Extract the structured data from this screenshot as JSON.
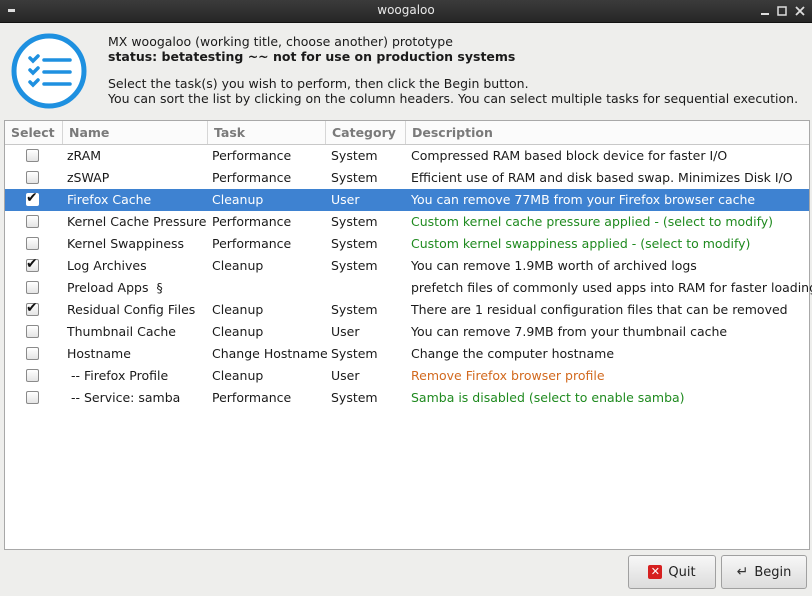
{
  "window": {
    "title": "woogaloo"
  },
  "header": {
    "title": "MX woogaloo (working title, choose another) prototype",
    "status": "status: betatesting ~~ not for use on production systems",
    "instructions_1": "Select the task(s) you wish to perform, then click the Begin button.",
    "instructions_2": "You can sort the list by clicking on the column headers. You can select multiple tasks for sequential execution."
  },
  "table": {
    "columns": [
      "Select",
      "Name",
      "Task",
      "Category",
      "Description"
    ],
    "rows": [
      {
        "checked": false,
        "name": "zRAM",
        "task": "Performance",
        "category": "System",
        "description": "Compressed RAM based block device for faster I/O",
        "desc_color": "normal",
        "selected": false
      },
      {
        "checked": false,
        "name": "zSWAP",
        "task": "Performance",
        "category": "System",
        "description": "Efficient use of RAM and disk based swap. Minimizes Disk I/O",
        "desc_color": "normal",
        "selected": false
      },
      {
        "checked": true,
        "name": "Firefox Cache",
        "task": "Cleanup",
        "category": "User",
        "description": "You can remove 77MB from your Firefox browser cache",
        "desc_color": "normal",
        "selected": true
      },
      {
        "checked": false,
        "name": "Kernel Cache Pressure",
        "task": "Performance",
        "category": "System",
        "description": "Custom kernel cache pressure applied - (select to modify)",
        "desc_color": "green",
        "selected": false
      },
      {
        "checked": false,
        "name": "Kernel Swappiness",
        "task": "Performance",
        "category": "System",
        "description": "Custom kernel swappiness applied - (select to modify)",
        "desc_color": "green",
        "selected": false
      },
      {
        "checked": true,
        "name": "Log Archives",
        "task": "Cleanup",
        "category": "System",
        "description": "You can remove 1.9MB worth of archived logs",
        "desc_color": "normal",
        "selected": false
      },
      {
        "checked": false,
        "name": "Preload Apps  §",
        "task": "",
        "category": "",
        "description": "prefetch files of commonly used apps into RAM for faster loading",
        "desc_color": "normal",
        "selected": false
      },
      {
        "checked": true,
        "name": "Residual Config Files",
        "task": "Cleanup",
        "category": "System",
        "description": "There are 1 residual configuration files that can be removed",
        "desc_color": "normal",
        "selected": false
      },
      {
        "checked": false,
        "name": "Thumbnail Cache",
        "task": "Cleanup",
        "category": "User",
        "description": "You can remove 7.9MB from your thumbnail cache",
        "desc_color": "normal",
        "selected": false
      },
      {
        "checked": false,
        "name": "Hostname",
        "task": "Change Hostname",
        "category": "System",
        "description": "Change the computer hostname",
        "desc_color": "normal",
        "selected": false
      },
      {
        "checked": false,
        "name": " -- Firefox Profile",
        "task": "Cleanup",
        "category": "User",
        "description": "Remove Firefox browser profile",
        "desc_color": "orange",
        "selected": false
      },
      {
        "checked": false,
        "name": " -- Service: samba",
        "task": "Performance",
        "category": "System",
        "description": "Samba is disabled (select to enable samba)",
        "desc_color": "green",
        "selected": false
      }
    ]
  },
  "buttons": {
    "quit": "Quit",
    "begin": "Begin"
  },
  "colors": {
    "selection": "#3e82d1",
    "green": "#1f8a1f",
    "orange": "#d2691e"
  }
}
